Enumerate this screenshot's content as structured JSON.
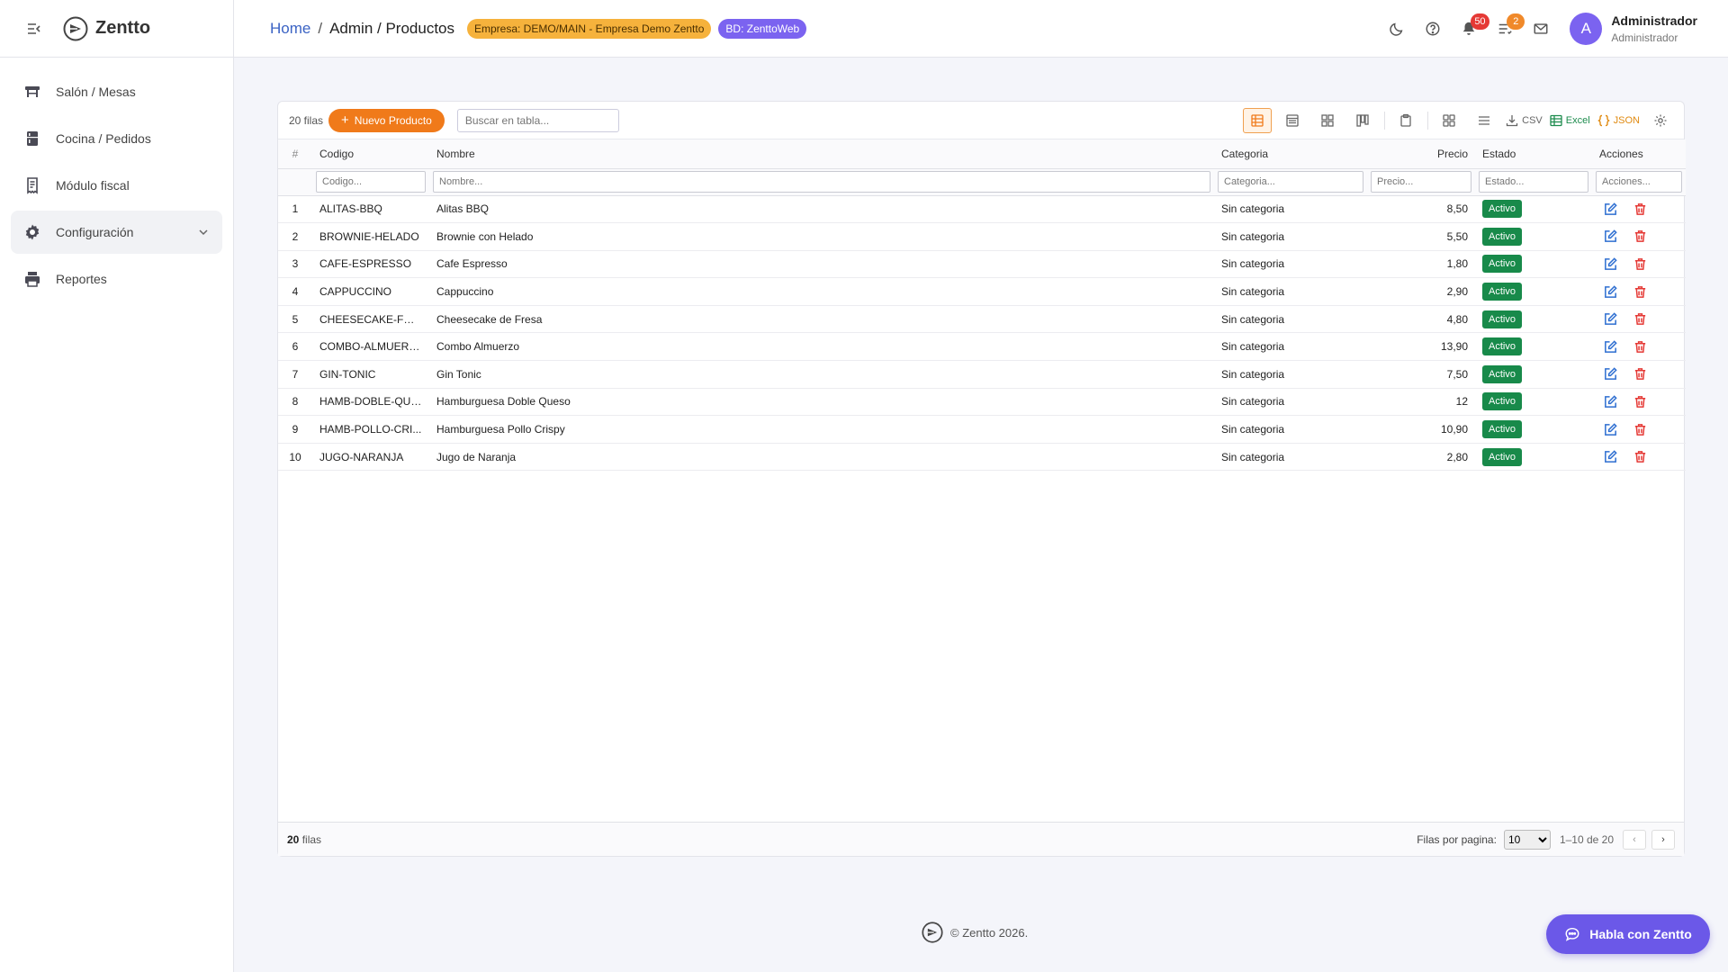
{
  "app": {
    "brand": "Zentto"
  },
  "sidebar": {
    "items": [
      {
        "label": "Salón / Mesas"
      },
      {
        "label": "Cocina / Pedidos"
      },
      {
        "label": "Módulo fiscal"
      },
      {
        "label": "Configuración"
      },
      {
        "label": "Reportes"
      }
    ]
  },
  "header": {
    "breadcrumb_home": "Home",
    "breadcrumb_sep": "/",
    "breadcrumb_current": "Admin / Productos",
    "empresa_pill": "Empresa: DEMO/MAIN - Empresa Demo Zentto",
    "bd_pill": "BD: ZenttoWeb",
    "notifications_count": "50",
    "tasks_count": "2",
    "avatar_letter": "A",
    "user_name": "Administrador",
    "user_role": "Administrador"
  },
  "toolbar": {
    "rows_count": "20 filas",
    "new_button": "Nuevo Producto",
    "search_placeholder": "Buscar en tabla...",
    "csv_label": "CSV",
    "excel_label": "Excel",
    "json_label": "JSON"
  },
  "table": {
    "columns": [
      "#",
      "Codigo",
      "Nombre",
      "Categoria",
      "Precio",
      "Estado",
      "Acciones"
    ],
    "filters": [
      "Codigo...",
      "Nombre...",
      "Categoria...",
      "Precio...",
      "Estado...",
      "Acciones..."
    ],
    "rows": [
      {
        "n": "1",
        "codigo": "ALITAS-BBQ",
        "nombre": "Alitas BBQ",
        "categoria": "Sin categoria",
        "precio": "8,50",
        "estado": "Activo"
      },
      {
        "n": "2",
        "codigo": "BROWNIE-HELADO",
        "nombre": "Brownie con Helado",
        "categoria": "Sin categoria",
        "precio": "5,50",
        "estado": "Activo"
      },
      {
        "n": "3",
        "codigo": "CAFE-ESPRESSO",
        "nombre": "Cafe Espresso",
        "categoria": "Sin categoria",
        "precio": "1,80",
        "estado": "Activo"
      },
      {
        "n": "4",
        "codigo": "CAPPUCCINO",
        "nombre": "Cappuccino",
        "categoria": "Sin categoria",
        "precio": "2,90",
        "estado": "Activo"
      },
      {
        "n": "5",
        "codigo": "CHEESECAKE-FRESA",
        "nombre": "Cheesecake de Fresa",
        "categoria": "Sin categoria",
        "precio": "4,80",
        "estado": "Activo"
      },
      {
        "n": "6",
        "codigo": "COMBO-ALMUERZO",
        "nombre": "Combo Almuerzo",
        "categoria": "Sin categoria",
        "precio": "13,90",
        "estado": "Activo"
      },
      {
        "n": "7",
        "codigo": "GIN-TONIC",
        "nombre": "Gin Tonic",
        "categoria": "Sin categoria",
        "precio": "7,50",
        "estado": "Activo"
      },
      {
        "n": "8",
        "codigo": "HAMB-DOBLE-QUE...",
        "nombre": "Hamburguesa Doble Queso",
        "categoria": "Sin categoria",
        "precio": "12",
        "estado": "Activo"
      },
      {
        "n": "9",
        "codigo": "HAMB-POLLO-CRI...",
        "nombre": "Hamburguesa Pollo Crispy",
        "categoria": "Sin categoria",
        "precio": "10,90",
        "estado": "Activo"
      },
      {
        "n": "10",
        "codigo": "JUGO-NARANJA",
        "nombre": "Jugo de Naranja",
        "categoria": "Sin categoria",
        "precio": "2,80",
        "estado": "Activo"
      }
    ]
  },
  "footer": {
    "count_number": "20",
    "count_label": "filas",
    "rows_per_page_label": "Filas por pagina:",
    "rows_per_page_value": "10",
    "range": "1–10 de 20",
    "prev": "‹",
    "next": "›"
  },
  "page_footer": {
    "copyright": "© Zentto 2026."
  },
  "chat": {
    "label": "Habla con Zentto"
  },
  "colors": {
    "accent_orange": "#f07a1a",
    "accent_purple": "#6b58e8",
    "status_green": "#188a4a",
    "edit_blue": "#2f6fd1",
    "delete_red": "#e53935"
  }
}
